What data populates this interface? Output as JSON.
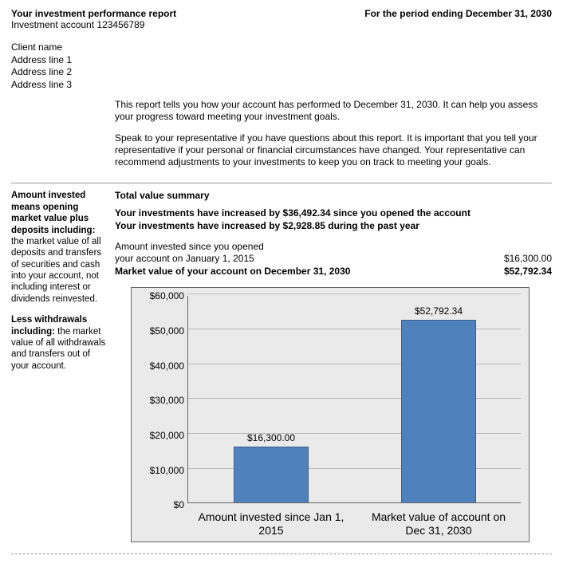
{
  "header": {
    "title": "Your investment performance report",
    "account_line": "Investment account 123456789",
    "period": "For the period ending December 31, 2030"
  },
  "address": {
    "client": "Client name",
    "line1": "Address line 1",
    "line2": "Address line 2",
    "line3": "Address line 3"
  },
  "intro": {
    "p1": "This report tells you how your account has performed to December 31, 2030. It can help you assess your progress toward meeting your investment goals.",
    "p2": "Speak to your representative if you have questions about this report. It is important that you tell your representative if your personal or financial circumstances have changed. Your representative can recommend adjustments to your investments to keep you on track to meeting your goals."
  },
  "sidebar": {
    "amount_lead": "Amount invested means opening market value plus deposits including:",
    "amount_body": " the market value of all deposits and transfers of securities and cash into your account, not including interest or dividends reinvested.",
    "less_lead": "Less withdrawals including:",
    "less_body": " the market value of all withdrawals and transfers out of your account."
  },
  "summary": {
    "title": "Total value summary",
    "inc1": "Your investments have increased by $36,492.34 since you opened the account",
    "inc2": "Your investments have increased by $2,928.85 during the past year",
    "row1_label_a": "Amount invested since you opened",
    "row1_label_b": "your account on January 1, 2015",
    "row1_value": "$16,300.00",
    "row2_label": "Market value of your account on December 31, 2030",
    "row2_value": "$52,792.34"
  },
  "chart_data": {
    "type": "bar",
    "categories": [
      "Amount invested since Jan 1, 2015",
      "Market value of account on Dec 31, 2030"
    ],
    "values": [
      16300.0,
      52792.34
    ],
    "value_labels": [
      "$16,300.00",
      "$52,792.34"
    ],
    "y_ticks": [
      "$0",
      "$10,000",
      "$20,000",
      "$30,000",
      "$40,000",
      "$50,000",
      "$60,000"
    ],
    "ylim": [
      0,
      60000
    ],
    "title": "",
    "xlabel": "",
    "ylabel": ""
  }
}
